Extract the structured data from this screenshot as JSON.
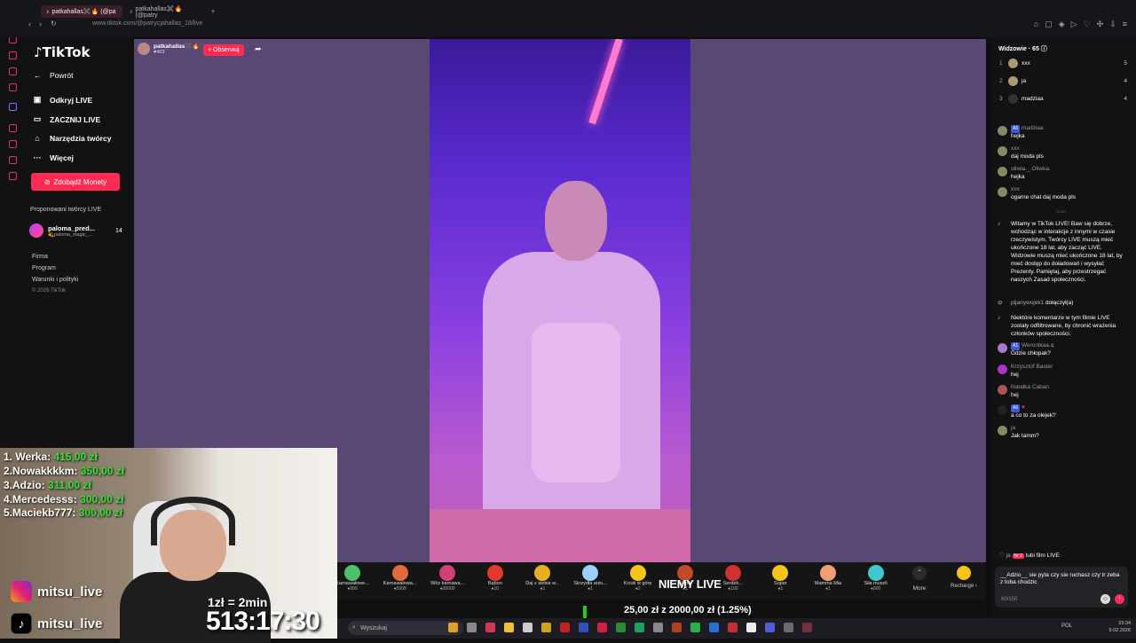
{
  "browser": {
    "tabs": [
      {
        "label": "patkahallas✖️🔥 (@pa"
      },
      {
        "label": "patkahallas✖️🔥 (@patry"
      }
    ],
    "new_tab": "+",
    "address": "www.tiktok.com/@patrycjahallas_18/live"
  },
  "sidebar": {
    "logo": "TikTok",
    "back": "Powrót",
    "nav": [
      {
        "label": "Odkryj LIVE",
        "icon": "live-icon"
      },
      {
        "label": "ZACZNIJ LIVE",
        "icon": "camera-icon"
      },
      {
        "label": "Narzędzia twórcy",
        "icon": "home-icon"
      },
      {
        "label": "Więcej",
        "icon": "more-icon"
      }
    ],
    "coins_button": "Zdobądź Monety",
    "suggested_title": "Proponowani twórcy LIVE",
    "suggested": {
      "name": "paloma_pred...",
      "sub": "💫paloma_magic_...",
      "count": "14"
    },
    "footer": [
      "Firma",
      "Program",
      "Warunki i polityki",
      "© 2026 TikTok"
    ]
  },
  "stream": {
    "host_name": "patkahallas✖️🔥",
    "host_likes": "♥403",
    "follow": "+ Obserwuj",
    "overlay_title": "NIEMY LIVE"
  },
  "gifts": [
    {
      "name": "Karnawałowe...",
      "price": "●999",
      "color": "#4cc06a"
    },
    {
      "name": "Karnawałowa...",
      "price": "●6999",
      "color": "#e06a3a"
    },
    {
      "name": "Wóz karnawa...",
      "price": "●20000",
      "color": "#d6407a"
    },
    {
      "name": "Bąbon",
      "price": "●10",
      "color": "#e03a2a"
    },
    {
      "name": "Daj z siebie w...",
      "price": "●1",
      "color": "#e8b020"
    },
    {
      "name": "Skrzydła anio...",
      "price": "●1",
      "color": "#9ad0ff"
    },
    {
      "name": "Kciuk w górę",
      "price": "●2",
      "color": "#f5c518"
    },
    {
      "name": "Napój",
      "price": "●1",
      "color": "#c04a2a"
    },
    {
      "name": "Serdek...",
      "price": "●100",
      "color": "#d03030"
    },
    {
      "name": "Super",
      "price": "●1",
      "color": "#f5c518"
    },
    {
      "name": "Mamma Mia",
      "price": "●1",
      "color": "#f0a070"
    },
    {
      "name": "Siła muszli",
      "price": "●900",
      "color": "#40c8d0"
    }
  ],
  "gift_more": "More",
  "recharge": "Recharge ›",
  "donation": {
    "text": "25,00 zł z 2000,00 zł (1.25%)",
    "progress": 0.0125
  },
  "taskbar": {
    "search": "Wyszukaj",
    "lang": "POL",
    "time": "23:34",
    "date": "9.02.2026"
  },
  "overlay": {
    "leaderboard": [
      {
        "name": "1. Werka:",
        "amount": "415,00 zł"
      },
      {
        "name": "2.Nowakkkkm:",
        "amount": "350,00 zł"
      },
      {
        "name": "3.Adzio:",
        "amount": "311,00 zł"
      },
      {
        "name": "4.Mercedesss:",
        "amount": "300,00 zł"
      },
      {
        "name": "5.Maciekb777:",
        "amount": "300,00 zł"
      }
    ],
    "instagram": "mitsu_live",
    "tiktok": "mitsu_live",
    "timer_label": "1zł = 2min",
    "timer": "513:17:30"
  },
  "chat": {
    "viewers_title": "Widzowie · 65 ⓘ",
    "viewers": [
      {
        "rank": "1",
        "name": "xxx",
        "count": "5"
      },
      {
        "rank": "2",
        "name": "ja",
        "count": "4"
      },
      {
        "rank": "3",
        "name": "madziaa",
        "count": "4"
      }
    ],
    "messages": [
      {
        "user": "madziaa",
        "badge": "A6",
        "text": "hejka"
      },
      {
        "user": "xxx",
        "badge": "",
        "text": "daj moda pls"
      },
      {
        "user": "oliwia._.Oliwka.",
        "badge": "",
        "text": "hejka"
      },
      {
        "user": "xxx",
        "badge": "",
        "text": "ogarne chat daj moda pls"
      }
    ],
    "divider": "Nowy",
    "system_welcome": "Witamy w TikTok LIVE! Baw się dobrze, wchodząc w interakcje z innymi w czasie rzeczywistym. Twórcy LIVE muszą mieć ukończone 18 lat, aby zacząć LIVE. Widzowie muszą mieć ukończone 18 lat, by mieć dostęp do doładowań i wysyłać Prezenty. Pamiętaj, aby przestrzegać naszych Zasad społeczności.",
    "joined": {
      "user": "pijanywujek1",
      "text": "dołączył(a)"
    },
    "system_filter": "Niektóre komentarze w tym filmie LIVE zostały odfiltrowane, by chronić wrażenia członków społeczności.",
    "messages2": [
      {
        "user": "Weronikaa.q",
        "badge": "A1",
        "text": "Gdzie chłopak?"
      },
      {
        "user": "Krzysztof Baster",
        "badge": "",
        "text": "hej"
      },
      {
        "user": "Natalka Caban",
        "badge": "",
        "text": "hej"
      },
      {
        "user": "",
        "badge": "A6",
        "text": "a co to za olejek?"
      },
      {
        "user": "ja",
        "badge": "",
        "text": "Jak tamm?"
      }
    ],
    "last": {
      "user": "ja",
      "badge": "Nr 2",
      "text": "lubi film LIVE"
    },
    "input_text": "__Adzio__ sie pyta czy sie ruchasz czy tr zeba z toba chodzic",
    "input_count": "60/150"
  }
}
